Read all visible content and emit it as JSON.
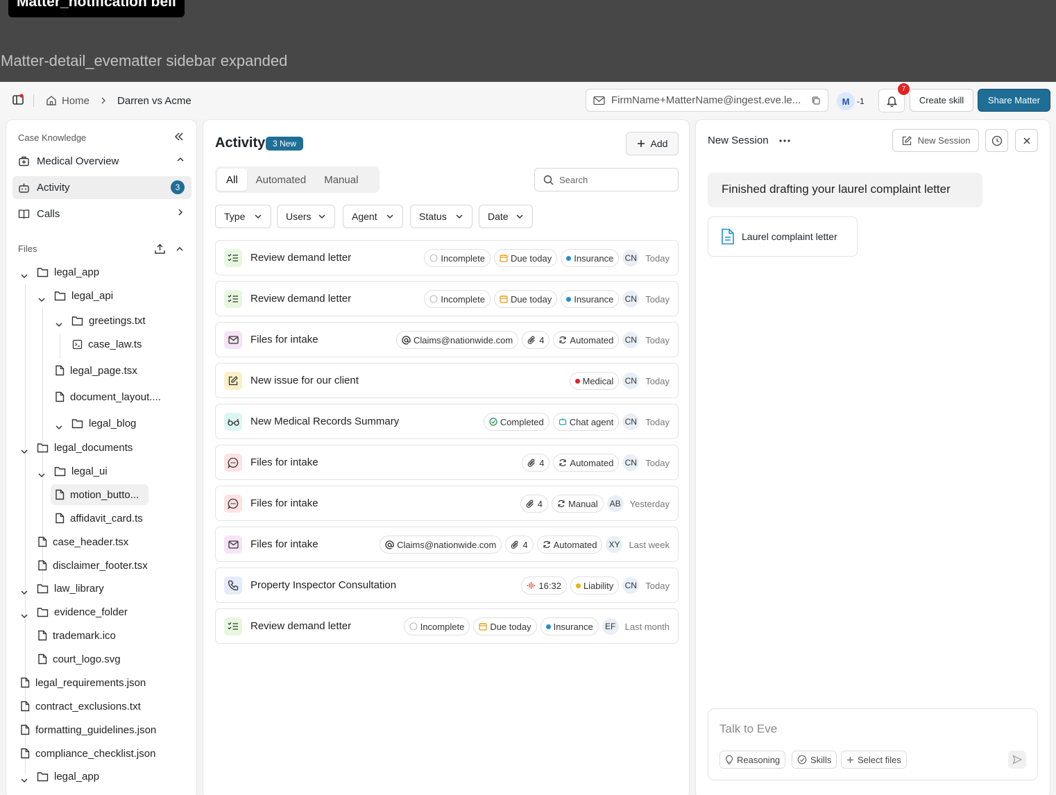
{
  "banner": {
    "tag": "Matter_notification bell",
    "subtitle": "Matter-detail_evematter sidebar expanded"
  },
  "topbar": {
    "breadcrumb": {
      "home": "Home",
      "current": "Darren vs Acme"
    },
    "email": "FirmName+MatterName@ingest.eve.le...",
    "member_initial": "M",
    "member_extra": "-1",
    "notification_count": "7",
    "create_skill": "Create skill",
    "share_matter": "Share Matter"
  },
  "sidebar": {
    "case_knowledge": "Case Knowledge",
    "nav": [
      {
        "label": "Medical Overview"
      },
      {
        "label": "Activity",
        "count": "3"
      },
      {
        "label": "Calls"
      }
    ],
    "files_label": "Files",
    "tree": [
      "legal_app",
      "legal_api",
      "greetings.txt",
      "case_law.ts",
      "legal_page.tsx",
      "document_layout....",
      "legal_blog",
      "legal_documents",
      "legal_ui",
      "motion_butto...",
      "affidavit_card.ts",
      "case_header.tsx",
      "disclaimer_footer.tsx",
      "law_library",
      "evidence_folder",
      "trademark.ico",
      "court_logo.svg",
      "legal_requirements.json",
      "contract_exclusions.txt",
      "formatting_guidelines.json",
      "compliance_checklist.json",
      "legal_app"
    ]
  },
  "activity": {
    "title": "Activity",
    "new_badge": "3 New",
    "add": "Add",
    "tabs": [
      "All",
      "Automated",
      "Manual"
    ],
    "search_placeholder": "Search",
    "filters": [
      "Type",
      "Users",
      "Agent",
      "Status",
      "Date"
    ],
    "rows": [
      {
        "title": "Review demand letter",
        "icon": "checklist-icon",
        "pills": [
          "Incomplete",
          "Due today",
          "Insurance"
        ],
        "initials": "CN",
        "when": "Today"
      },
      {
        "title": "Review demand letter",
        "icon": "checklist-icon",
        "pills": [
          "Incomplete",
          "Due today",
          "Insurance"
        ],
        "initials": "CN",
        "when": "Today"
      },
      {
        "title": "Files for intake",
        "icon": "mail-icon",
        "pills": [
          "Claims@nationwide.com",
          "4",
          "Automated"
        ],
        "initials": "CN",
        "when": "Today"
      },
      {
        "title": "New issue for our client",
        "icon": "edit-note-icon",
        "pills": [
          "Medical"
        ],
        "initials": "CN",
        "when": "Today"
      },
      {
        "title": "New Medical Records Summary",
        "icon": "glasses-icon",
        "pills": [
          "Completed",
          "Chat agent"
        ],
        "initials": "CN",
        "when": "Today"
      },
      {
        "title": "Files for intake",
        "icon": "chat-icon",
        "pills": [
          "4",
          "Automated"
        ],
        "initials": "CN",
        "when": "Today"
      },
      {
        "title": "Files for intake",
        "icon": "chat-icon",
        "pills": [
          "4",
          "Manual"
        ],
        "initials": "AB",
        "when": "Yesterday"
      },
      {
        "title": "Files for intake",
        "icon": "mail-icon",
        "pills": [
          "Claims@nationwide.com",
          "4",
          "Automated"
        ],
        "initials": "XY",
        "when": "Last week"
      },
      {
        "title": "Property Inspector Consultation",
        "icon": "phone-icon",
        "pills": [
          "16:32",
          "Liability"
        ],
        "initials": "CN",
        "when": "Today"
      },
      {
        "title": "Review demand letter",
        "icon": "checklist-icon",
        "pills": [
          "Incomplete",
          "Due today",
          "Insurance"
        ],
        "initials": "EF",
        "when": "Last month"
      }
    ]
  },
  "chat": {
    "title": "New Session",
    "new_session": "New Session",
    "message": "Finished drafting your laurel complaint letter",
    "doc_name": "Laurel complaint letter",
    "input_placeholder": "Talk to Eve",
    "chips": [
      "Reasoning",
      "Skills",
      "Select files"
    ]
  },
  "colors": {
    "accent": "#1f6e96",
    "insurance_dot": "#1f8fd0",
    "medical_dot": "#e02424",
    "liability_dot": "#e8b500"
  }
}
